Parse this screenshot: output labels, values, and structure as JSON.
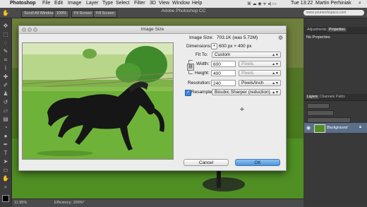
{
  "menubar": {
    "apple": "",
    "items": [
      "Photoshop",
      "File",
      "Edit",
      "Image",
      "Layer",
      "Type",
      "Select",
      "Filter",
      "3D",
      "View",
      "Window",
      "Help"
    ],
    "clock": "Tue 13:22",
    "user": "Martin Perhiniak"
  },
  "app": {
    "title": "Adobe Photoshop CC"
  },
  "options": {
    "scroll_all": "Scroll All Windows",
    "zoom_100": "100%",
    "fit_screen": "Fit Screen",
    "fill_screen": "Fill Screen",
    "search_text": "www.yourworkspace.com"
  },
  "panels": {
    "top_tabs": [
      "Adjustments",
      "Properties"
    ],
    "no_properties": "No Properties",
    "layer_tabs": [
      "Layers",
      "Channels",
      "Paths"
    ],
    "layer_name": "Background"
  },
  "status": {
    "zoom": "11.95%",
    "efficiency": "Efficiency: 100%*"
  },
  "dialog": {
    "title": "Image Size",
    "image_size_label": "Image Size:",
    "image_size_value": "703.1K (was 5.72M)",
    "dimensions_label": "Dimensions:",
    "dimensions_value": "600 px  ×  400 px",
    "fit_to_label": "Fit To:",
    "fit_to_value": "Custom",
    "width_label": "Width:",
    "width_value": "600",
    "width_unit": "Pixels",
    "height_label": "Height:",
    "height_value": "400",
    "height_unit": "Pixels",
    "resolution_label": "Resolution:",
    "resolution_value": "240",
    "resolution_unit": "Pixels/Inch",
    "resample_label": "Resample:",
    "resample_checked": true,
    "resample_value": "Bicubic Sharper (reduction)",
    "cancel_label": "Cancel",
    "ok_label": "OK"
  }
}
